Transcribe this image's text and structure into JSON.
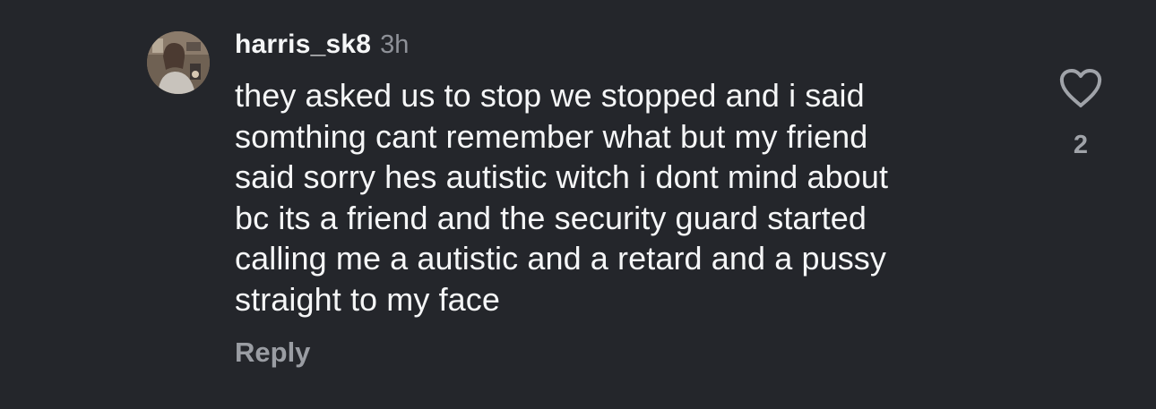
{
  "comment": {
    "username": "harris_sk8",
    "timestamp": "3h",
    "text": "they asked us to stop we stopped and i said\nsomthing cant remember what but my friend\nsaid sorry hes autistic witch i dont mind about\nbc its a friend and the security guard started\ncalling me a autistic and a retard and a pussy\nstraight to my face",
    "reply_label": "Reply",
    "like_count": "2",
    "like_icon": "heart-outline-icon",
    "avatar": "avatar-photo"
  },
  "colors": {
    "background": "#24262b",
    "text": "#f5f6f7",
    "muted": "#9a9da3"
  }
}
